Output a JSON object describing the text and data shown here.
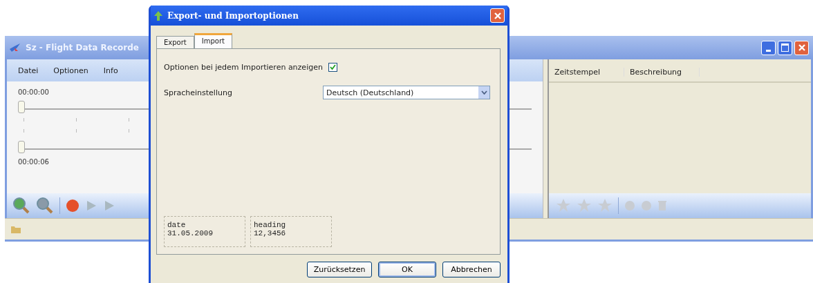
{
  "main_window": {
    "title": "Sz - Flight Data Recorde",
    "menu": [
      "Datei",
      "Optionen",
      "Info"
    ],
    "timeline": {
      "start_time": "00:00:00",
      "end_time": "00:00:06",
      "sliders": [
        {
          "level": 0
        },
        {
          "level": 0
        }
      ]
    },
    "list_columns": [
      "Zeitstempel",
      "Beschreibung"
    ]
  },
  "dialog": {
    "title": "Export- und Importoptionen",
    "tabs": [
      {
        "label": "Export",
        "selected": false
      },
      {
        "label": "Import",
        "selected": true
      }
    ],
    "show_options": {
      "label": "Optionen bei jedem Importieren anzeigen",
      "checked": true
    },
    "language": {
      "label": "Spracheinstellung",
      "value": "Deutsch (Deutschland)"
    },
    "fields": [
      {
        "name": "date",
        "value": "31.05.2009"
      },
      {
        "name": "heading",
        "value": "12,3456"
      }
    ],
    "buttons": [
      {
        "label": "Zurücksetzen",
        "default": false
      },
      {
        "label": "OK",
        "default": true
      },
      {
        "label": "Abbrechen",
        "default": false
      }
    ]
  }
}
